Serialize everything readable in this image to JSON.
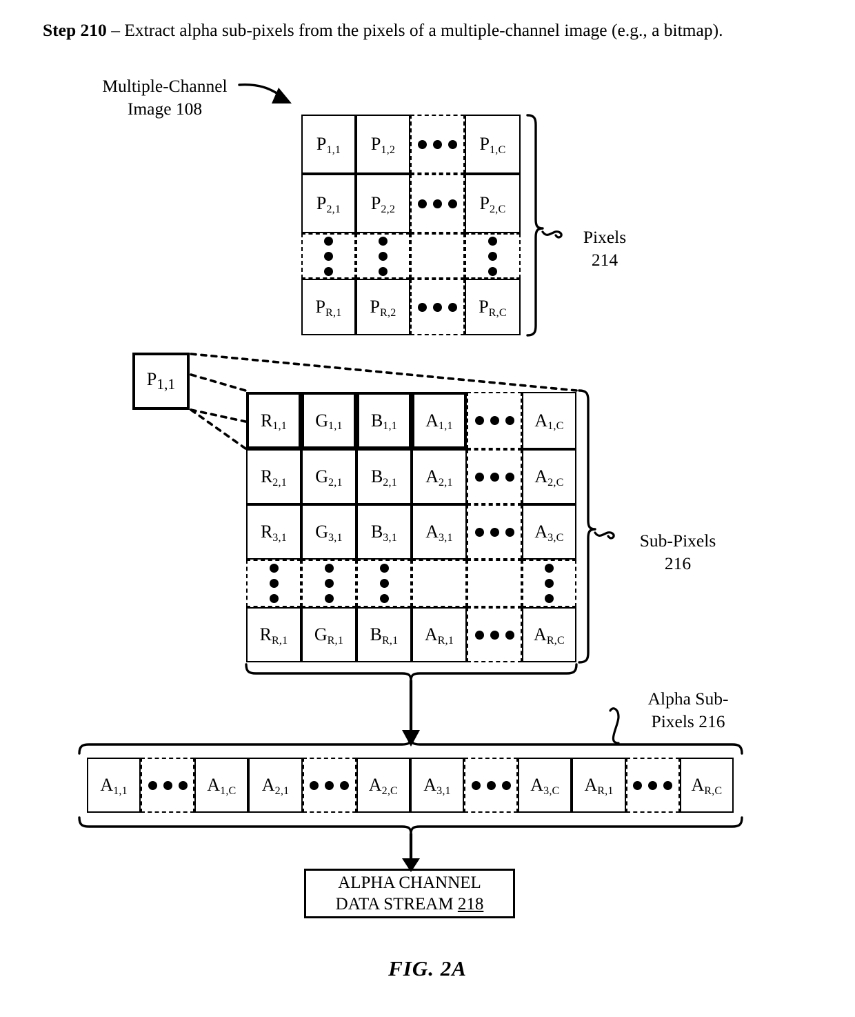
{
  "header": {
    "step_label": "Step 210",
    "step_text": " – Extract alpha sub-pixels from the pixels of a multiple-channel image (e.g., a bitmap)."
  },
  "labels": {
    "multiple_channel_image": "Multiple-Channel\nImage 108",
    "multiple_channel_image_line1": "Multiple-Channel",
    "multiple_channel_image_line2": "Image 108",
    "pixels_line1": "Pixels",
    "pixels_line2": "214",
    "subpixels_line1": "Sub-Pixels",
    "subpixels_line2": "216",
    "alpha_subpixels_line1": "Alpha Sub-",
    "alpha_subpixels_line2": "Pixels 216"
  },
  "pixel_grid": {
    "name": "Multiple-Channel Image 108 pixel grid",
    "rows": 4,
    "cols": 4,
    "cells": [
      [
        {
          "t": "P",
          "s": "1,1",
          "k": "solid"
        },
        {
          "t": "P",
          "s": "1,2",
          "k": "solid"
        },
        {
          "k": "dashed",
          "d": "h"
        },
        {
          "t": "P",
          "s": "1,C",
          "k": "solid"
        }
      ],
      [
        {
          "t": "P",
          "s": "2,1",
          "k": "solid"
        },
        {
          "t": "P",
          "s": "2,2",
          "k": "solid"
        },
        {
          "k": "dashed",
          "d": "h"
        },
        {
          "t": "P",
          "s": "2,C",
          "k": "solid"
        }
      ],
      [
        {
          "k": "dashed",
          "d": "v"
        },
        {
          "k": "dashed",
          "d": "v"
        },
        {
          "k": "dashed"
        },
        {
          "k": "dashed",
          "d": "v"
        }
      ],
      [
        {
          "t": "P",
          "s": "R,1",
          "k": "solid"
        },
        {
          "t": "P",
          "s": "R,2",
          "k": "solid"
        },
        {
          "k": "dashed",
          "d": "h"
        },
        {
          "t": "P",
          "s": "R,C",
          "k": "solid"
        }
      ]
    ]
  },
  "pixel_callout": {
    "t": "P",
    "s": "1,1"
  },
  "subpixel_grid": {
    "name": "Sub-Pixels 216 grid",
    "rows": 5,
    "cols": 6,
    "cells": [
      [
        {
          "t": "R",
          "s": "1,1",
          "k": "thick"
        },
        {
          "t": "G",
          "s": "1,1",
          "k": "thick"
        },
        {
          "t": "B",
          "s": "1,1",
          "k": "thick"
        },
        {
          "t": "A",
          "s": "1,1",
          "k": "thick"
        },
        {
          "k": "dashed",
          "d": "h"
        },
        {
          "t": "A",
          "s": "1,C",
          "k": "solid"
        }
      ],
      [
        {
          "t": "R",
          "s": "2,1",
          "k": "solid"
        },
        {
          "t": "G",
          "s": "2,1",
          "k": "solid"
        },
        {
          "t": "B",
          "s": "2,1",
          "k": "solid"
        },
        {
          "t": "A",
          "s": "2,1",
          "k": "solid"
        },
        {
          "k": "dashed",
          "d": "h"
        },
        {
          "t": "A",
          "s": "2,C",
          "k": "solid"
        }
      ],
      [
        {
          "t": "R",
          "s": "3,1",
          "k": "solid"
        },
        {
          "t": "G",
          "s": "3,1",
          "k": "solid"
        },
        {
          "t": "B",
          "s": "3,1",
          "k": "solid"
        },
        {
          "t": "A",
          "s": "3,1",
          "k": "solid"
        },
        {
          "k": "dashed",
          "d": "h"
        },
        {
          "t": "A",
          "s": "3,C",
          "k": "solid"
        }
      ],
      [
        {
          "k": "dashed",
          "d": "v"
        },
        {
          "k": "dashed",
          "d": "v"
        },
        {
          "k": "dashed",
          "d": "v"
        },
        {
          "k": "dashed"
        },
        {
          "k": "dashed"
        },
        {
          "k": "dashed",
          "d": "v"
        }
      ],
      [
        {
          "t": "R",
          "s": "R,1",
          "k": "solid"
        },
        {
          "t": "G",
          "s": "R,1",
          "k": "solid"
        },
        {
          "t": "B",
          "s": "R,1",
          "k": "solid"
        },
        {
          "t": "A",
          "s": "R,1",
          "k": "solid"
        },
        {
          "k": "dashed",
          "d": "h"
        },
        {
          "t": "A",
          "s": "R,C",
          "k": "solid"
        }
      ]
    ]
  },
  "alpha_strip": {
    "name": "Alpha Sub-Pixels 216 linear strip",
    "cells": [
      {
        "t": "A",
        "s": "1,1",
        "k": "solid"
      },
      {
        "k": "dashed",
        "d": "h"
      },
      {
        "t": "A",
        "s": "1,C",
        "k": "solid"
      },
      {
        "t": "A",
        "s": "2,1",
        "k": "solid"
      },
      {
        "k": "dashed",
        "d": "h"
      },
      {
        "t": "A",
        "s": "2,C",
        "k": "solid"
      },
      {
        "t": "A",
        "s": "3,1",
        "k": "solid"
      },
      {
        "k": "dashed",
        "d": "h"
      },
      {
        "t": "A",
        "s": "3,C",
        "k": "solid"
      },
      {
        "t": "A",
        "s": "R,1",
        "k": "solid"
      },
      {
        "k": "dashed",
        "d": "h"
      },
      {
        "t": "A",
        "s": "R,C",
        "k": "solid"
      }
    ]
  },
  "alpha_stream_box": {
    "line1": "ALPHA CHANNEL",
    "line2_prefix": "DATA STREAM ",
    "line2_ref": "218"
  },
  "figure_caption": "FIG. 2A",
  "colors": {
    "ink": "#000000",
    "paper": "#ffffff"
  }
}
